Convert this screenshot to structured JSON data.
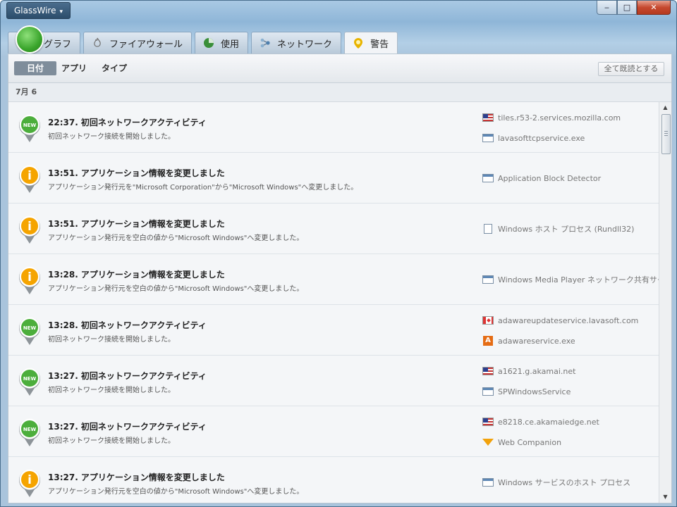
{
  "app": {
    "menu_label": "GlassWire",
    "menu_caret": "▾"
  },
  "window_buttons": {
    "minimize": "‒",
    "maximize": "□",
    "close": "✕"
  },
  "tabs": [
    {
      "label": "グラフ",
      "icon": "glasswire-logo-icon"
    },
    {
      "label": "ファイアウォール",
      "icon": "flame-icon"
    },
    {
      "label": "使用",
      "icon": "pie-icon"
    },
    {
      "label": "ネットワーク",
      "icon": "network-icon"
    },
    {
      "label": "警告",
      "icon": "alert-bulb-icon",
      "active": true
    }
  ],
  "filters": {
    "date": "日付",
    "app": "アプリ",
    "type": "タイプ",
    "mark_all_read": "全て既読とする"
  },
  "date_header": "7月 6",
  "alerts": [
    {
      "badge": "new",
      "title": "22:37. 初回ネットワークアクティビティ",
      "subtitle": "初回ネットワーク接続を開始しました。",
      "entities": [
        {
          "icon": "flag-us",
          "text": "tiles.r53-2.services.mozilla.com"
        },
        {
          "icon": "window",
          "text": "lavasofttcpservice.exe"
        }
      ]
    },
    {
      "badge": "info",
      "title": "13:51. アプリケーション情報を変更しました",
      "subtitle": "アプリケーション発行元を\"Microsoft Corporation\"から\"Microsoft Windows\"へ変更しました。",
      "entities": [
        {
          "icon": "window",
          "text": "Application Block Detector"
        }
      ]
    },
    {
      "badge": "info",
      "title": "13:51. アプリケーション情報を変更しました",
      "subtitle": "アプリケーション発行元を空白の値から\"Microsoft Windows\"へ変更しました。",
      "entities": [
        {
          "icon": "document",
          "text": "Windows ホスト プロセス (Rundll32)"
        }
      ]
    },
    {
      "badge": "info",
      "title": "13:28. アプリケーション情報を変更しました",
      "subtitle": "アプリケーション発行元を空白の値から\"Microsoft Windows\"へ変更しました。",
      "entities": [
        {
          "icon": "window",
          "text": "Windows Media Player ネットワーク共有サー…"
        }
      ]
    },
    {
      "badge": "new",
      "title": "13:28. 初回ネットワークアクティビティ",
      "subtitle": "初回ネットワーク接続を開始しました。",
      "entities": [
        {
          "icon": "flag-ca",
          "text": "adawareupdateservice.lavasoft.com"
        },
        {
          "icon": "adaware",
          "text": "adawareservice.exe"
        }
      ]
    },
    {
      "badge": "new",
      "title": "13:27. 初回ネットワークアクティビティ",
      "subtitle": "初回ネットワーク接続を開始しました。",
      "entities": [
        {
          "icon": "flag-us",
          "text": "a1621.g.akamai.net"
        },
        {
          "icon": "window",
          "text": "SPWindowsService"
        }
      ]
    },
    {
      "badge": "new",
      "title": "13:27. 初回ネットワークアクティビティ",
      "subtitle": "初回ネットワーク接続を開始しました。",
      "entities": [
        {
          "icon": "flag-us",
          "text": "e8218.ce.akamaiedge.net"
        },
        {
          "icon": "web-companion",
          "text": "Web Companion"
        }
      ]
    },
    {
      "badge": "info",
      "title": "13:27. アプリケーション情報を変更しました",
      "subtitle": "アプリケーション発行元を空白の値から\"Microsoft Windows\"へ変更しました。",
      "entities": [
        {
          "icon": "window",
          "text": "Windows サービスのホスト プロセス"
        }
      ]
    }
  ],
  "badges": {
    "new_text": "NEW",
    "info_text": "i"
  },
  "colors": {
    "new_green": "#4cae3c",
    "info_orange": "#f5a400",
    "accent_blue": "#2d3f8e"
  }
}
